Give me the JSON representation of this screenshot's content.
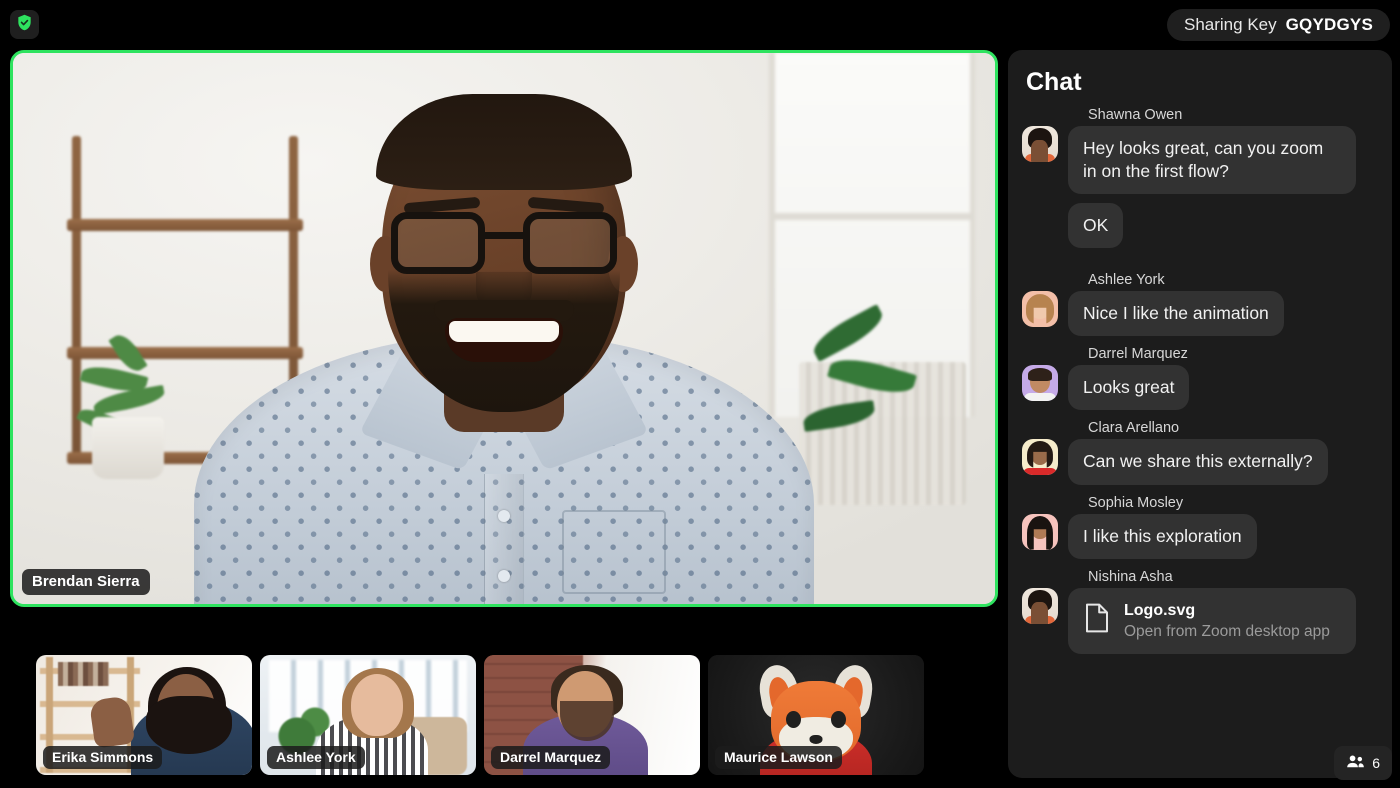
{
  "topbar": {
    "security_icon": "shield-check-icon",
    "sharing_key_label": "Sharing Key",
    "sharing_key_value": "GQYDGYS"
  },
  "stage": {
    "active_speaker": "Brendan Sierra",
    "highlight_color": "#2ee35f"
  },
  "filmstrip": [
    {
      "name": "Erika Simmons"
    },
    {
      "name": "Ashlee York"
    },
    {
      "name": "Darrel Marquez"
    },
    {
      "name": "Maurice Lawson"
    }
  ],
  "chat": {
    "title": "Chat",
    "messages": [
      {
        "sender": "Shawna Owen",
        "avatar": "av-a",
        "bubbles": [
          "Hey looks great, can you zoom in on the first flow?",
          "OK"
        ]
      },
      {
        "sender": "Ashlee York",
        "avatar": "av-b",
        "bubbles": [
          "Nice I like the animation"
        ]
      },
      {
        "sender": "Darrel Marquez",
        "avatar": "av-c",
        "bubbles": [
          "Looks great"
        ]
      },
      {
        "sender": "Clara Arellano",
        "avatar": "av-d",
        "bubbles": [
          "Can we share this externally?"
        ]
      },
      {
        "sender": "Sophia Mosley",
        "avatar": "av-e",
        "bubbles": [
          "I like this exploration"
        ]
      }
    ],
    "file_message": {
      "sender": "Nishina Asha",
      "avatar": "av-a",
      "file_icon": "document-icon",
      "file_name": "Logo.svg",
      "file_action": "Open from Zoom desktop app"
    }
  },
  "participants_badge": {
    "icon": "people-icon",
    "count": "6"
  }
}
